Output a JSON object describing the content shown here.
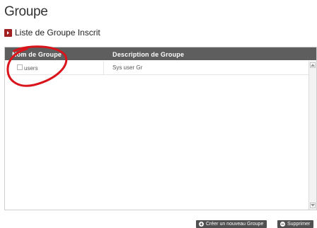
{
  "page": {
    "title": "Groupe"
  },
  "section": {
    "heading": "Liste de Groupe Inscrit",
    "icon": "arrow-right-icon",
    "icon_color": "#a32020"
  },
  "table": {
    "columns": [
      "Nom de Groupe",
      "Description de Groupe"
    ],
    "rows": [
      {
        "name": "users",
        "description": "Sys user Gr",
        "checked": false
      }
    ],
    "header_color": "#5e5e5e"
  },
  "annotation": {
    "color": "#d9151b"
  },
  "actions": {
    "create_label": "Créer un nouveau Groupe",
    "create_icon": "plus-icon",
    "delete_label": "Supprimer",
    "delete_icon": "minus-icon"
  }
}
